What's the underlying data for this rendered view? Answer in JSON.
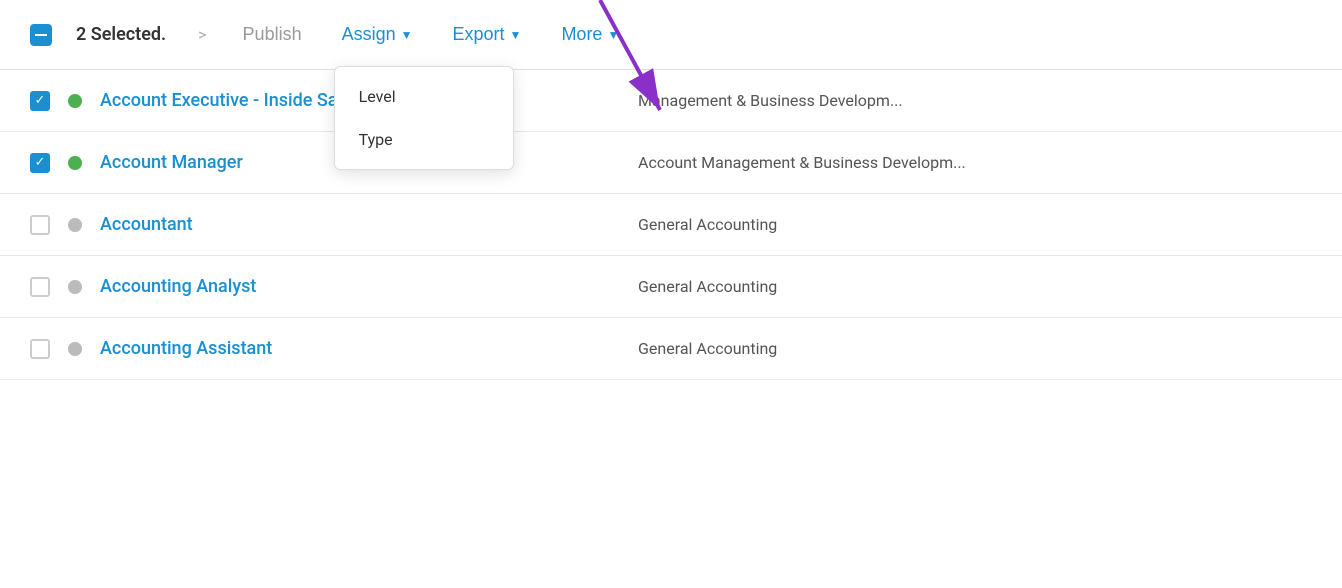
{
  "toolbar": {
    "selected_text": "2 Selected.",
    "chevron": ">",
    "publish_label": "Publish",
    "assign_label": "Assign",
    "export_label": "Export",
    "more_label": "More"
  },
  "assign_dropdown": {
    "items": [
      {
        "label": "Level"
      },
      {
        "label": "Type"
      }
    ]
  },
  "rows": [
    {
      "id": "row-1",
      "checked": true,
      "status": "active",
      "title": "Account Executive - Inside Sales",
      "category": "Management & Business Developm..."
    },
    {
      "id": "row-2",
      "checked": true,
      "status": "active",
      "title": "Account Manager",
      "category": "Account Management & Business Developm..."
    },
    {
      "id": "row-3",
      "checked": false,
      "status": "inactive",
      "title": "Accountant",
      "category": "General Accounting"
    },
    {
      "id": "row-4",
      "checked": false,
      "status": "inactive",
      "title": "Accounting Analyst",
      "category": "General Accounting"
    },
    {
      "id": "row-5",
      "checked": false,
      "status": "inactive",
      "title": "Accounting Assistant",
      "category": "General Accounting"
    }
  ]
}
